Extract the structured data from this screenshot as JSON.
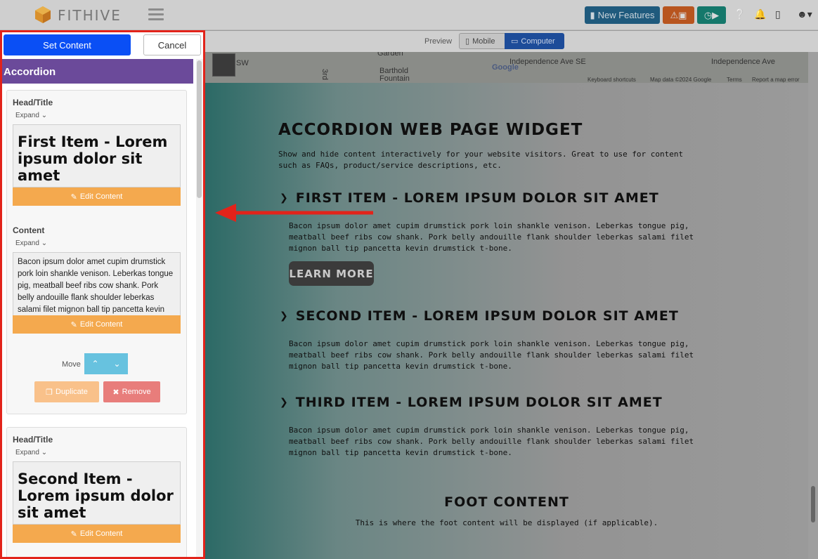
{
  "nav": {
    "brand": "FITHIVE",
    "new_features": "New Features"
  },
  "preview": {
    "label": "Preview",
    "mobile": "Mobile",
    "computer": "Computer"
  },
  "map": {
    "labels": [
      "Garden",
      "SW",
      "Barthold Fountain",
      "3rd",
      "Independence Ave SE",
      "Independence Ave"
    ],
    "footer": [
      "Keyboard shortcuts",
      "Map data ©2024 Google",
      "Terms",
      "Report a map error"
    ],
    "google": "Google"
  },
  "widget": {
    "title": "ACCORDION WEB PAGE WIDGET",
    "description": "Show and hide content interactively for your website visitors. Great to use for content such as FAQs, product/service descriptions, etc.",
    "items": [
      {
        "head": "FIRST ITEM - LOREM IPSUM DOLOR SIT AMET",
        "body": "Bacon ipsum dolor amet cupim drumstick pork loin shankle venison. Leberkas tongue pig, meatball beef ribs cow shank. Pork belly andouille flank shoulder leberkas salami filet mignon ball tip pancetta kevin drumstick t-bone."
      },
      {
        "head": "SECOND ITEM - LOREM IPSUM DOLOR SIT AMET",
        "body": "Bacon ipsum dolor amet cupim drumstick pork loin shankle venison. Leberkas tongue pig, meatball beef ribs cow shank. Pork belly andouille flank shoulder leberkas salami filet mignon ball tip pancetta kevin drumstick t-bone."
      },
      {
        "head": "THIRD ITEM - LOREM IPSUM DOLOR SIT AMET",
        "body": "Bacon ipsum dolor amet cupim drumstick pork loin shankle venison. Leberkas tongue pig, meatball beef ribs cow shank. Pork belly andouille flank shoulder leberkas salami filet mignon ball tip pancetta kevin drumstick t-bone."
      }
    ],
    "learn_more": "LEARN MORE",
    "foot_title": "FOOT CONTENT",
    "foot_text": "This is where the foot content will be displayed (if applicable)."
  },
  "editor": {
    "set_content": "Set Content",
    "cancel": "Cancel",
    "section_title": "Accordion",
    "head_label": "Head/Title",
    "content_label": "Content",
    "expand": "Expand",
    "edit_content": "Edit Content",
    "move": "Move",
    "duplicate": "Duplicate",
    "remove": "Remove",
    "item1_head": "First Item - Lorem ipsum dolor sit amet",
    "item1_content": "Bacon ipsum dolor amet cupim drumstick pork loin shankle venison. Leberkas tongue pig, meatball beef ribs cow shank. Pork belly andouille flank shoulder leberkas salami filet mignon ball tip pancetta kevin drumstick t-bone.",
    "item2_head": "Second Item - Lorem ipsum dolor sit amet"
  },
  "colors": {
    "accent": "#0a4ff5",
    "panel_header": "#6b4a9a",
    "edit_button": "#f4a94e",
    "highlight_border": "#e2231a"
  }
}
